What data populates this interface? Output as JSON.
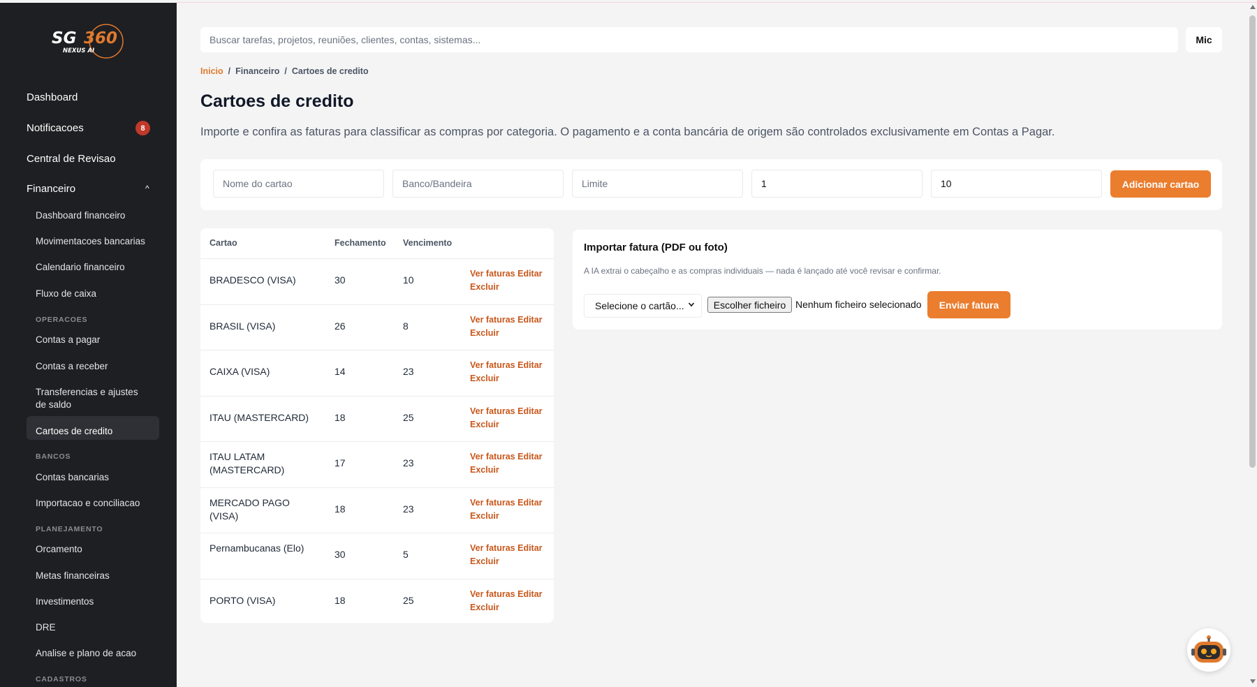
{
  "sidebar": {
    "brand": "SG360",
    "brand_sub": "NEXUS AI",
    "items": {
      "dashboard": "Dashboard",
      "notificacoes": "Notificacoes",
      "notificacoes_badge": "8",
      "central": "Central de Revisao",
      "financeiro": "Financeiro",
      "financeiro_caret": "^"
    },
    "sub": {
      "dashboard_fin": "Dashboard financeiro",
      "movimentacoes": "Movimentacoes bancarias",
      "calendario": "Calendario financeiro",
      "fluxo": "Fluxo de caixa",
      "sec_operacoes": "OPERACOES",
      "contas_pagar": "Contas a pagar",
      "contas_receber": "Contas a receber",
      "transferencias_1": "Transferencias e ajustes",
      "transferencias_2": "de saldo",
      "cartoes": "Cartoes de credito",
      "sec_bancos": "BANCOS",
      "contas_bancarias": "Contas bancarias",
      "importacao": "Importacao e conciliacao",
      "sec_planejamento": "PLANEJAMENTO",
      "orcamento": "Orcamento",
      "metas": "Metas financeiras",
      "investimentos": "Investimentos",
      "dre": "DRE",
      "analise": "Analise e plano de acao",
      "sec_cadastros": "CADASTROS"
    }
  },
  "header": {
    "search_placeholder": "Buscar tarefas, projetos, reuniões, clientes, contas, sistemas...",
    "mic_label": "Mic"
  },
  "breadcrumb": {
    "home": "Inicio",
    "sep": "/",
    "level1": "Financeiro",
    "level2": "Cartoes de credito"
  },
  "page": {
    "title": "Cartoes de credito",
    "description": "Importe e confira as faturas para classificar as compras por categoria. O pagamento e a conta bancária de origem são controlados exclusivamente em Contas a Pagar."
  },
  "form": {
    "name_placeholder": "Nome do cartao",
    "bank_placeholder": "Banco/Bandeira",
    "limit_placeholder": "Limite",
    "closing_value": "1",
    "due_value": "10",
    "add_label": "Adicionar cartao"
  },
  "table": {
    "headers": [
      "Cartao",
      "Fechamento",
      "Vencimento"
    ],
    "action_view": "Ver faturas",
    "action_edit": "Editar",
    "action_delete": "Excluir",
    "rows": [
      {
        "name": "BRADESCO (VISA)",
        "closing": "30",
        "due": "10"
      },
      {
        "name": "BRASIL (VISA)",
        "closing": "26",
        "due": "8"
      },
      {
        "name": "CAIXA (VISA)",
        "closing": "14",
        "due": "23"
      },
      {
        "name": "ITAU (MASTERCARD)",
        "closing": "18",
        "due": "25"
      },
      {
        "name": "ITAU LATAM (MASTERCARD)",
        "closing": "17",
        "due": "23"
      },
      {
        "name": "MERCADO PAGO (VISA)",
        "closing": "18",
        "due": "23"
      },
      {
        "name": "Pernambucanas (Elo)",
        "closing": "30",
        "due": "5"
      },
      {
        "name": "PORTO (VISA)",
        "closing": "18",
        "due": "25"
      }
    ]
  },
  "import": {
    "title": "Importar fatura (PDF ou foto)",
    "description": "A IA extrai o cabeçalho e as compras individuais — nada é lançado até você revisar e confirmar.",
    "select_label": "Selecione o cartão...",
    "file_button": "Escolher ficheiro",
    "file_status": "Nenhum ficheiro selecionado",
    "send_label": "Enviar fatura"
  },
  "colors": {
    "accent": "#ea7d2e",
    "action_link": "#c8571b",
    "sidebar_bg": "#1e1f22",
    "badge": "#c0392b"
  }
}
